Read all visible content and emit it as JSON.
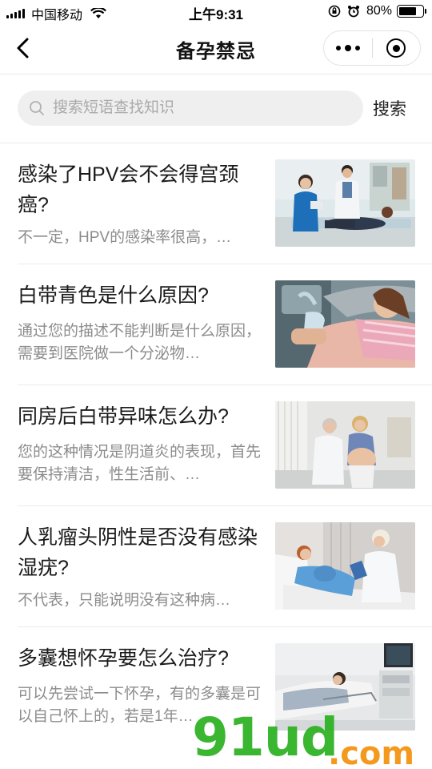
{
  "status_bar": {
    "carrier": "中国移动",
    "time": "上午9:31",
    "battery_text": "80%",
    "battery_level": 0.8
  },
  "nav": {
    "title": "备孕禁忌",
    "back_icon": "chevron-left-icon",
    "more_icon": "more-dots-icon",
    "close_icon": "target-circle-icon"
  },
  "search": {
    "placeholder": "搜索短语查找知识",
    "value": "",
    "button_label": "搜索"
  },
  "articles": [
    {
      "title": "感染了HPV会不会得宫颈癌?",
      "summary": "不一定，HPV的感染率很高，…",
      "image": "doctor-exam-photo"
    },
    {
      "title": "白带青色是什么原因?",
      "summary": "通过您的描述不能判断是什么原因，需要到医院做一个分泌物…",
      "image": "ultrasound-photo"
    },
    {
      "title": "同房后白带异味怎么办?",
      "summary": "您的这种情况是阴道炎的表现，首先要保持清洁，性生活前、…",
      "image": "pregnancy-consult-photo"
    },
    {
      "title": "人乳瘤头阴性是否没有感染湿疣?",
      "summary": "不代表，只能说明没有这种病…",
      "image": "hospital-bed-photo"
    },
    {
      "title": "多囊想怀孕要怎么治疗?",
      "summary": "可以先尝试一下怀孕，有的多囊是可以自己怀上的，若是1年…",
      "image": "ward-monitor-photo"
    }
  ],
  "watermark": {
    "main": "91ud",
    "suffix": ".com"
  },
  "colors": {
    "watermark_green": "#2ab01f",
    "watermark_orange": "#f39a1e",
    "text_primary": "#1a1a1a",
    "text_secondary": "#8c8c8c",
    "search_bg": "#efefef"
  }
}
